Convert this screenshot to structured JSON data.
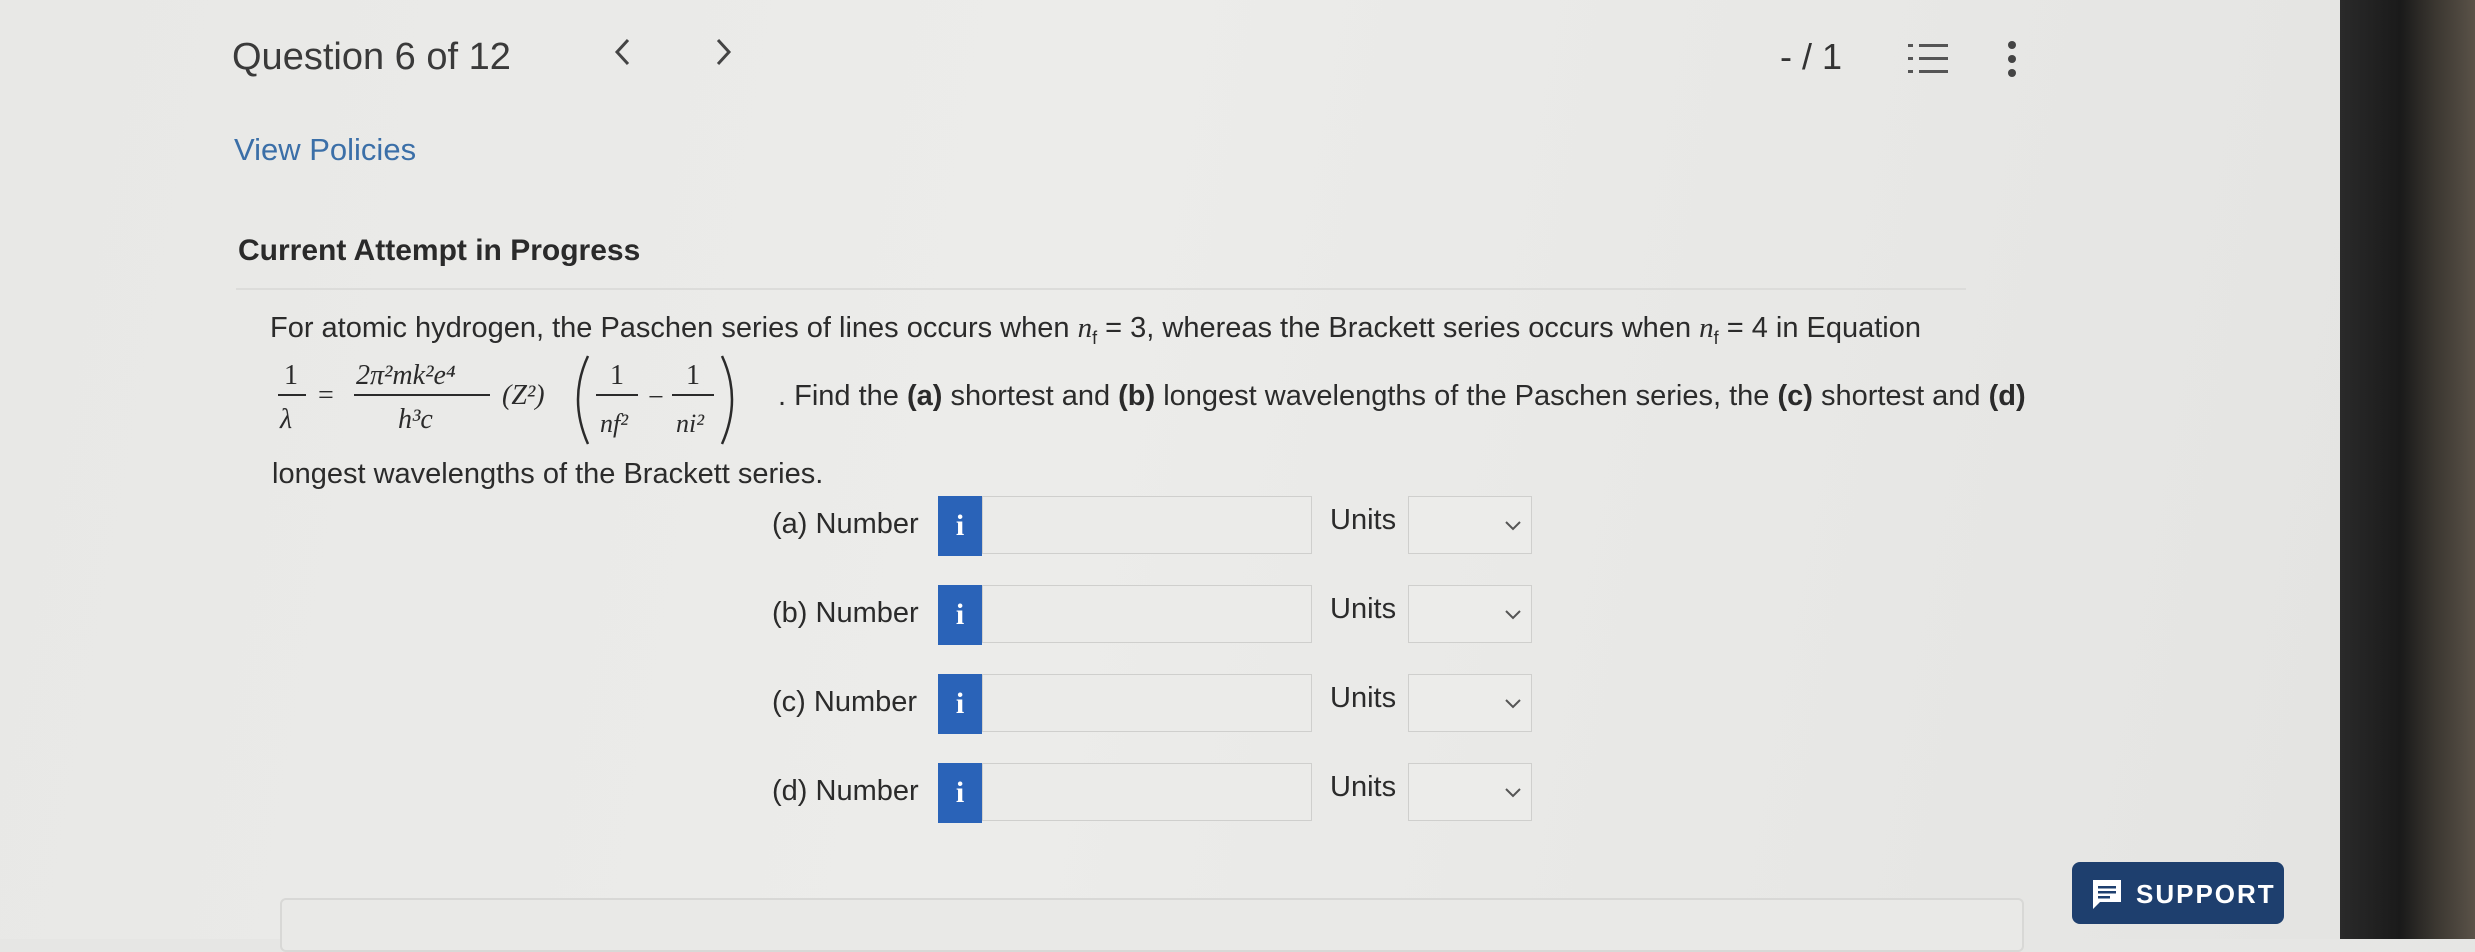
{
  "header": {
    "question_title": "Question 6 of 12",
    "prev_label": "<",
    "next_label": ">",
    "score": "- / 1"
  },
  "links": {
    "view_policies": "View Policies"
  },
  "attempt": {
    "status": "Current Attempt in Progress"
  },
  "prompt": {
    "line1_a": "For atomic hydrogen, the Paschen series of lines occurs when ",
    "nf_symbol": "n",
    "nf_sub": "f",
    "line1_b": " = 3, whereas the Brackett series occurs when ",
    "line1_c": " = 4 in Equation",
    "line2_a": ". Find the ",
    "a_tag": "(a)",
    "line2_b": " shortest and ",
    "b_tag": "(b)",
    "line2_c": " longest wavelengths of the Paschen series, the ",
    "c_tag": "(c)",
    "line2_d": " shortest and ",
    "d_tag": "(d)",
    "line3": "longest wavelengths of the Brackett series."
  },
  "equation": {
    "lhs_num": "1",
    "lhs_den": "λ",
    "equals": "=",
    "num": "2π²mk²e⁴",
    "den": "h³c",
    "z_term": "(Z²)",
    "one_a": "1",
    "nf2": "nf²",
    "minus": "−",
    "one_b": "1",
    "ni2": "ni²"
  },
  "answers": [
    {
      "label": "(a) Number",
      "info": "i",
      "value": "",
      "units_label": "Units",
      "unit_selected": ""
    },
    {
      "label": "(b) Number",
      "info": "i",
      "value": "",
      "units_label": "Units",
      "unit_selected": ""
    },
    {
      "label": "(c) Number",
      "info": "i",
      "value": "",
      "units_label": "Units",
      "unit_selected": ""
    },
    {
      "label": "(d) Number",
      "info": "i",
      "value": "",
      "units_label": "Units",
      "unit_selected": ""
    }
  ],
  "support": {
    "label": "SUPPORT"
  },
  "colors": {
    "info_button": "#2a63b8",
    "link": "#3b6fa8",
    "support_button": "#1e3f6e"
  },
  "icons": [
    "chevron-left-icon",
    "chevron-right-icon",
    "numbered-list-icon",
    "more-vertical-icon",
    "info-icon",
    "chevron-down-icon",
    "chat-icon"
  ]
}
